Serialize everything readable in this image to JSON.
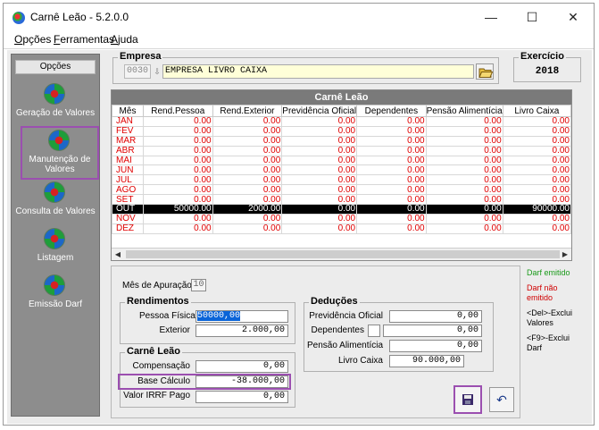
{
  "window": {
    "title": "Carnê Leão - 5.2.0.0",
    "minimize": "—",
    "maximize": "☐",
    "close": "✕"
  },
  "menu": {
    "opcoes": {
      "underline": "O",
      "rest": "pções"
    },
    "ferramentas": {
      "underline": "F",
      "rest": "erramentas"
    },
    "ajuda": {
      "underline": "A",
      "rest": "juda"
    }
  },
  "sidebar": {
    "title": "Opções",
    "items": [
      {
        "label": "Geração de Valores",
        "icon": "globe-icon"
      },
      {
        "label": "Manutenção de Valores",
        "icon": "globe-icon"
      },
      {
        "label": "Consulta de Valores",
        "icon": "globe-icon"
      },
      {
        "label": "Listagem",
        "icon": "globe-icon"
      },
      {
        "label": "Emissão Darf",
        "icon": "globe-icon"
      }
    ]
  },
  "empresa": {
    "title": "Empresa",
    "code": "0030",
    "name": "EMPRESA LIVRO CAIXA"
  },
  "exercicio": {
    "title": "Exercício",
    "value": "2018"
  },
  "grid": {
    "title": "Carnê Leão",
    "columns": [
      "Mês",
      "Rend.Pessoa",
      "Rend.Exterior",
      "Previdência Oficial",
      "Dependentes",
      "Pensão Alimentícia",
      "Livro Caixa"
    ],
    "rows": [
      [
        "JAN",
        "0.00",
        "0.00",
        "0.00",
        "0.00",
        "0.00",
        "0.00"
      ],
      [
        "FEV",
        "0.00",
        "0.00",
        "0.00",
        "0.00",
        "0.00",
        "0.00"
      ],
      [
        "MAR",
        "0.00",
        "0.00",
        "0.00",
        "0.00",
        "0.00",
        "0.00"
      ],
      [
        "ABR",
        "0.00",
        "0.00",
        "0.00",
        "0.00",
        "0.00",
        "0.00"
      ],
      [
        "MAI",
        "0.00",
        "0.00",
        "0.00",
        "0.00",
        "0.00",
        "0.00"
      ],
      [
        "JUN",
        "0.00",
        "0.00",
        "0.00",
        "0.00",
        "0.00",
        "0.00"
      ],
      [
        "JUL",
        "0.00",
        "0.00",
        "0.00",
        "0.00",
        "0.00",
        "0.00"
      ],
      [
        "AGO",
        "0.00",
        "0.00",
        "0.00",
        "0.00",
        "0.00",
        "0.00"
      ],
      [
        "SET",
        "0.00",
        "0.00",
        "0.00",
        "0.00",
        "0.00",
        "0.00"
      ],
      [
        "OUT",
        "50000.00",
        "2000.00",
        "0.00",
        "0.00",
        "0.00",
        "90000.00"
      ],
      [
        "NOV",
        "0.00",
        "0.00",
        "0.00",
        "0.00",
        "0.00",
        "0.00"
      ],
      [
        "DEZ",
        "0.00",
        "0.00",
        "0.00",
        "0.00",
        "0.00",
        "0.00"
      ]
    ],
    "selected_row": 9
  },
  "apuracao": {
    "label": "Mês de Apuração:",
    "value": "10"
  },
  "rendimentos": {
    "title": "Rendimentos",
    "pessoa_fisica_label": "Pessoa Física",
    "pessoa_fisica_value": "50000,00",
    "exterior_label": "Exterior",
    "exterior_value": "2.000,00"
  },
  "carne_leao": {
    "title": "Carnê Leão",
    "compensacao_label": "Compensação",
    "compensacao_value": "0,00",
    "base_calculo_label": "Base Cálculo",
    "base_calculo_value": "-38.000,00",
    "irrf_label": "Valor IRRF Pago",
    "irrf_value": "0,00"
  },
  "deducoes": {
    "title": "Deduções",
    "previdencia_label": "Previdência Oficial",
    "previdencia_value": "0,00",
    "dependentes_label": "Dependentes",
    "dependentes_count": "",
    "dependentes_value": "0,00",
    "pensao_label": "Pensão Alimentícia",
    "pensao_value": "0,00",
    "livro_caixa_label": "Livro Caixa",
    "livro_caixa_value": "90.000,00"
  },
  "legend": {
    "darf_emitido": "Darf emitido",
    "darf_nao_emitido": "Darf não emitido",
    "del_hint": "<Del>-Exclui Valores",
    "f9_hint": "<F9>-Exclui Darf"
  },
  "colors": {
    "green": "#1a9a1a",
    "red": "#d00000",
    "highlight": "#9b4fb0"
  }
}
